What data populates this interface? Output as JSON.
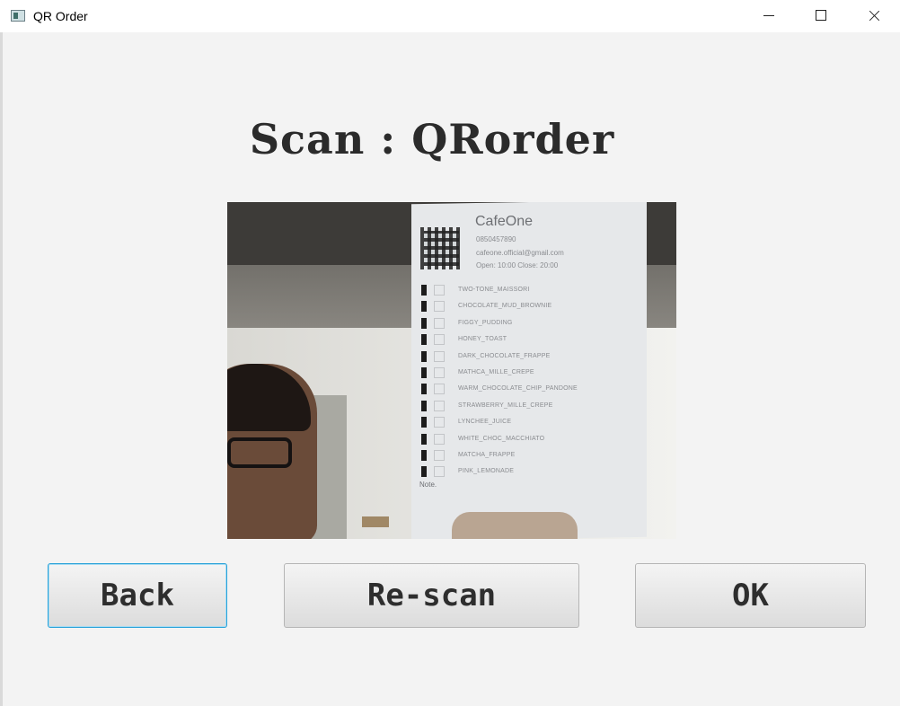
{
  "window": {
    "title": "QR Order",
    "controls": {
      "minimize_icon": "minimize-icon",
      "maximize_icon": "maximize-icon",
      "close_icon": "close-icon"
    }
  },
  "main": {
    "heading": "Scan : QRorder"
  },
  "camera_preview": {
    "cafe_name": "CafeOne",
    "lines": [
      "0850457890",
      "cafeone.official@gmail.com",
      "Open: 10:00  Close: 20:00"
    ],
    "menu_items": [
      "TWO-TONE_MAISSORI",
      "CHOCOLATE_MUD_BROWNIE",
      "FIGGY_PUDDING",
      "HONEY_TOAST",
      "DARK_CHOCOLATE_FRAPPE",
      "MATHCA_MILLE_CREPE",
      "WARM_CHOCOLATE_CHIP_PANDONE",
      "STRAWBERRY_MILLE_CREPE",
      "LYNCHEE_JUICE",
      "WHITE_CHOC_MACCHIATO",
      "MATCHA_FRAPPE",
      "PINK_LEMONADE"
    ],
    "note": "Note."
  },
  "buttons": {
    "back": "Back",
    "rescan": "Re-scan",
    "ok": "OK"
  }
}
